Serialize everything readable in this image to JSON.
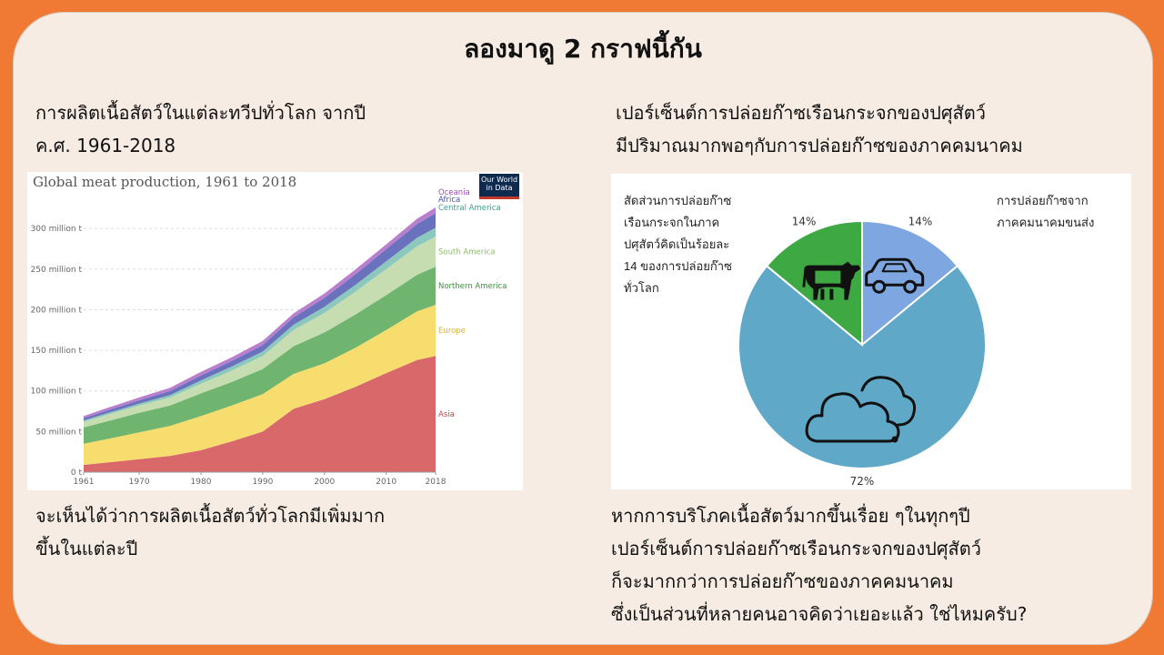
{
  "slide": {
    "title": "ลองมาดู 2 กราฟนี้กัน",
    "left_heading": [
      "การผลิตเนื้อสัตว์ในแต่ละทวีปทั่วโลก จากปี",
      "ค.ศ. 1961-2018"
    ],
    "right_heading": [
      "เปอร์เซ็นต์การปล่อยก๊าซเรือนกระจกของปศุสัตว์",
      "มีปริมาณมากพอๆกับการปล่อยก๊าซของภาคคมนาคม"
    ],
    "left_conclusion": [
      "จะเห็นได้ว่าการผลิตเนื้อสัตว์ทั่วโลกมีเพิ่มมาก",
      "ขึ้นในแต่ละปี"
    ],
    "right_conclusion": [
      "หากการบริโภคเนื้อสัตว์มากขึ้นเรื่อย ๆในทุกๆปี",
      "เปอร์เซ็นต์การปล่อยก๊าซเรือนกระจกของปศุสัตว์",
      "ก็จะมากกว่าการปล่อยก๊าซของภาคคมนาคม",
      "ซึ่งเป็นส่วนที่หลายคนอาจคิดว่าเยอะแล้ว ใช่ไหมครับ?"
    ]
  },
  "owid_logo": [
    "Our World",
    "in Data"
  ],
  "pie_notes": {
    "left": [
      "สัดส่วนการปล่อยก๊าซ",
      "เรือนกระจกในภาค",
      "ปศุสัตว์คิดเป็นร้อยละ",
      "14 ของการปล่อยก๊าซ",
      "ทั่วโลก"
    ],
    "right": [
      "การปล่อยก๊าซจาก",
      "ภาคคมนาคมขนส่ง"
    ]
  },
  "chart_data": [
    {
      "type": "area",
      "stacked": true,
      "title": "Global meat production, 1961 to 2018",
      "x": [
        1961,
        1965,
        1970,
        1975,
        1980,
        1985,
        1990,
        1995,
        2000,
        2005,
        2010,
        2015,
        2018
      ],
      "x_ticks": [
        1961,
        1970,
        1980,
        1990,
        2000,
        2010,
        2018
      ],
      "y_ticks": [
        0,
        50,
        100,
        150,
        200,
        250,
        300
      ],
      "y_tick_labels": [
        "0 t",
        "50 million t",
        "100 million t",
        "150 million t",
        "200 million t",
        "250 million t",
        "300 million t"
      ],
      "ylim": [
        0,
        345
      ],
      "grid": true,
      "legend": "right-inline",
      "series": [
        {
          "name": "Asia",
          "color": "#d9686a",
          "values": [
            9,
            12,
            16,
            20,
            27,
            38,
            50,
            78,
            90,
            105,
            122,
            138,
            143
          ]
        },
        {
          "name": "Europe",
          "color": "#f7dd6e",
          "values": [
            26,
            29,
            33,
            37,
            42,
            44,
            46,
            43,
            44,
            48,
            53,
            60,
            63
          ]
        },
        {
          "name": "Northern America",
          "color": "#6fb56f",
          "values": [
            20,
            22,
            24,
            25,
            28,
            29,
            31,
            34,
            38,
            41,
            43,
            45,
            47
          ]
        },
        {
          "name": "South America",
          "color": "#c5ddb0",
          "values": [
            7,
            8,
            9,
            10,
            12,
            14,
            16,
            20,
            24,
            28,
            32,
            35,
            37
          ]
        },
        {
          "name": "Central America",
          "color": "#8cc8bd",
          "values": [
            1.5,
            2,
            2.5,
            3,
            4,
            5,
            5.5,
            6.5,
            7.5,
            8.5,
            9.5,
            10.5,
            11
          ]
        },
        {
          "name": "Africa",
          "color": "#6a72bd",
          "values": [
            3,
            3.5,
            4,
            5,
            6,
            7,
            8,
            9,
            11,
            13,
            15,
            17,
            18
          ]
        },
        {
          "name": "Oceania",
          "color": "#b97fce",
          "values": [
            2.5,
            3,
            3.5,
            4,
            4.5,
            4.5,
            5,
            5,
            5.5,
            6,
            6,
            6.5,
            7
          ]
        }
      ]
    },
    {
      "type": "pie",
      "labels": [
        "14%",
        "72%",
        "14%"
      ],
      "values": [
        14,
        72,
        14
      ],
      "colors": [
        "#7ea6e0",
        "#5fa8c8",
        "#3ea843"
      ],
      "icons": [
        "car-icon",
        "cloud-icon",
        "cow-icon"
      ]
    }
  ]
}
